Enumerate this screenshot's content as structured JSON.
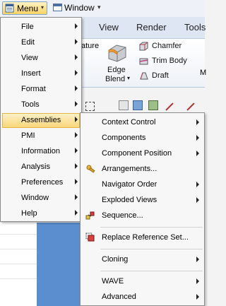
{
  "quick_access": {
    "menu_label": "Menu",
    "window_label": "Window",
    "caret": "▾",
    "more": "▾"
  },
  "ribbon": {
    "tabs": [
      "View",
      "Render",
      "Tools"
    ],
    "feature_fragment": "ature",
    "edge_blend_line1": "Edge",
    "edge_blend_line2": "Blend",
    "edge_caret": "▾",
    "chamfer": "Chamfer",
    "trim_body": "Trim Body",
    "draft": "Draft",
    "more_fragment": "M"
  },
  "main_menu": {
    "items": [
      {
        "label": "File",
        "mnemonic": "F",
        "has_submenu": true
      },
      {
        "label": "Edit",
        "mnemonic": "E",
        "has_submenu": true
      },
      {
        "label": "View",
        "mnemonic": "V",
        "has_submenu": true
      },
      {
        "label": "Insert",
        "mnemonic": "s",
        "has_submenu": true
      },
      {
        "label": "Format",
        "mnemonic": "r",
        "has_submenu": true
      },
      {
        "label": "Tools",
        "mnemonic": "T",
        "has_submenu": true
      },
      {
        "label": "Assemblies",
        "mnemonic": "A",
        "has_submenu": true,
        "highlighted": true
      },
      {
        "label": "PMI",
        "mnemonic": "M",
        "has_submenu": true
      },
      {
        "label": "Information",
        "mnemonic": "I",
        "has_submenu": true
      },
      {
        "label": "Analysis",
        "mnemonic": "l",
        "has_submenu": true
      },
      {
        "label": "Preferences",
        "mnemonic": "P",
        "has_submenu": true
      },
      {
        "label": "Window",
        "mnemonic": "W",
        "has_submenu": true
      },
      {
        "label": "Help",
        "mnemonic": "H",
        "has_submenu": true
      }
    ]
  },
  "assemblies_menu": {
    "items": [
      {
        "label": "Context Control",
        "has_submenu": true,
        "icon": ""
      },
      {
        "label": "Components",
        "has_submenu": true,
        "icon": ""
      },
      {
        "label": "Component Position",
        "has_submenu": true,
        "icon": ""
      },
      {
        "label": "Arrangements...",
        "has_submenu": false,
        "icon": "arrangements-icon"
      },
      {
        "label": "Navigator Order",
        "has_submenu": true,
        "icon": ""
      },
      {
        "label": "Exploded Views",
        "has_submenu": true,
        "icon": ""
      },
      {
        "label": "Sequence...",
        "has_submenu": false,
        "icon": "sequence-icon"
      },
      {
        "label": "Replace Reference Set...",
        "has_submenu": false,
        "icon": "replace-reference-set-icon"
      },
      {
        "label": "Cloning",
        "has_submenu": true,
        "icon": ""
      },
      {
        "label": "WAVE",
        "has_submenu": true,
        "icon": ""
      },
      {
        "label": "Advanced",
        "has_submenu": true,
        "icon": ""
      }
    ]
  },
  "colors": {
    "highlight_top": "#fdf0c6",
    "highlight_bottom": "#f9d77a",
    "graphics_bg": "#5b8ecf",
    "menu_bg": "#f7f7f7"
  }
}
